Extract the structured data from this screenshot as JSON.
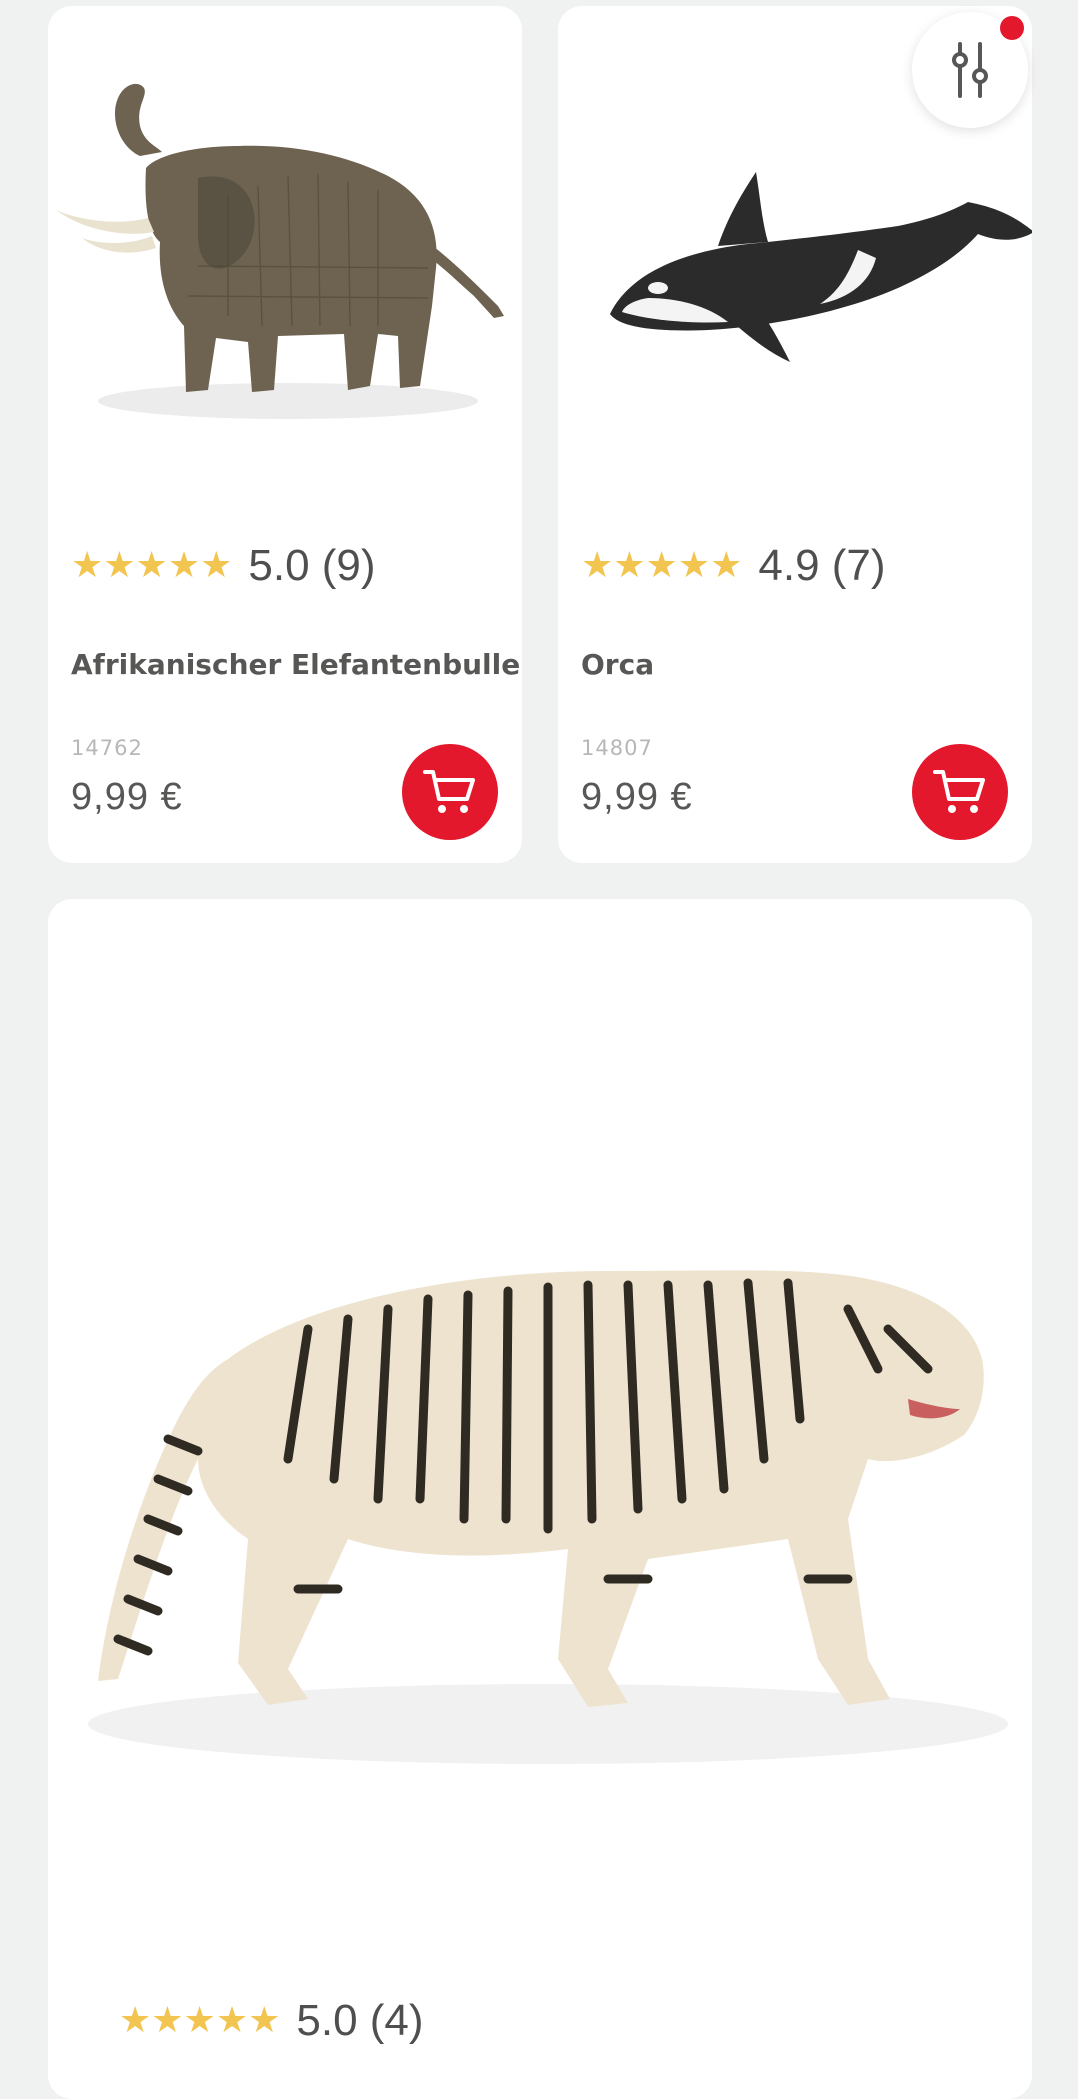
{
  "products": [
    {
      "name": "Afrikanischer Elefantenbulle",
      "stars": "★★★★★",
      "rating": "5.0 (9)",
      "sku": "14762",
      "price": "9,99 €",
      "image_icon": "elephant-figure-image"
    },
    {
      "name": "Orca",
      "stars": "★★★★★",
      "rating": "4.9 (7)",
      "sku": "14807",
      "price": "9,99 €",
      "image_icon": "orca-figure-image"
    },
    {
      "stars": "★★★★★",
      "rating": "5.0 (4)",
      "image_icon": "white-tiger-figure-image"
    }
  ],
  "filter": {
    "icon": "sliders-icon",
    "has_active_badge": true
  },
  "cart_icon": "cart-icon",
  "colors": {
    "background": "#f0f1f1",
    "card": "#ffffff",
    "accent_red": "#e3182d",
    "star_yellow": "#f2c550",
    "text_dark": "#575756",
    "text_light": "#b7b7b7"
  }
}
